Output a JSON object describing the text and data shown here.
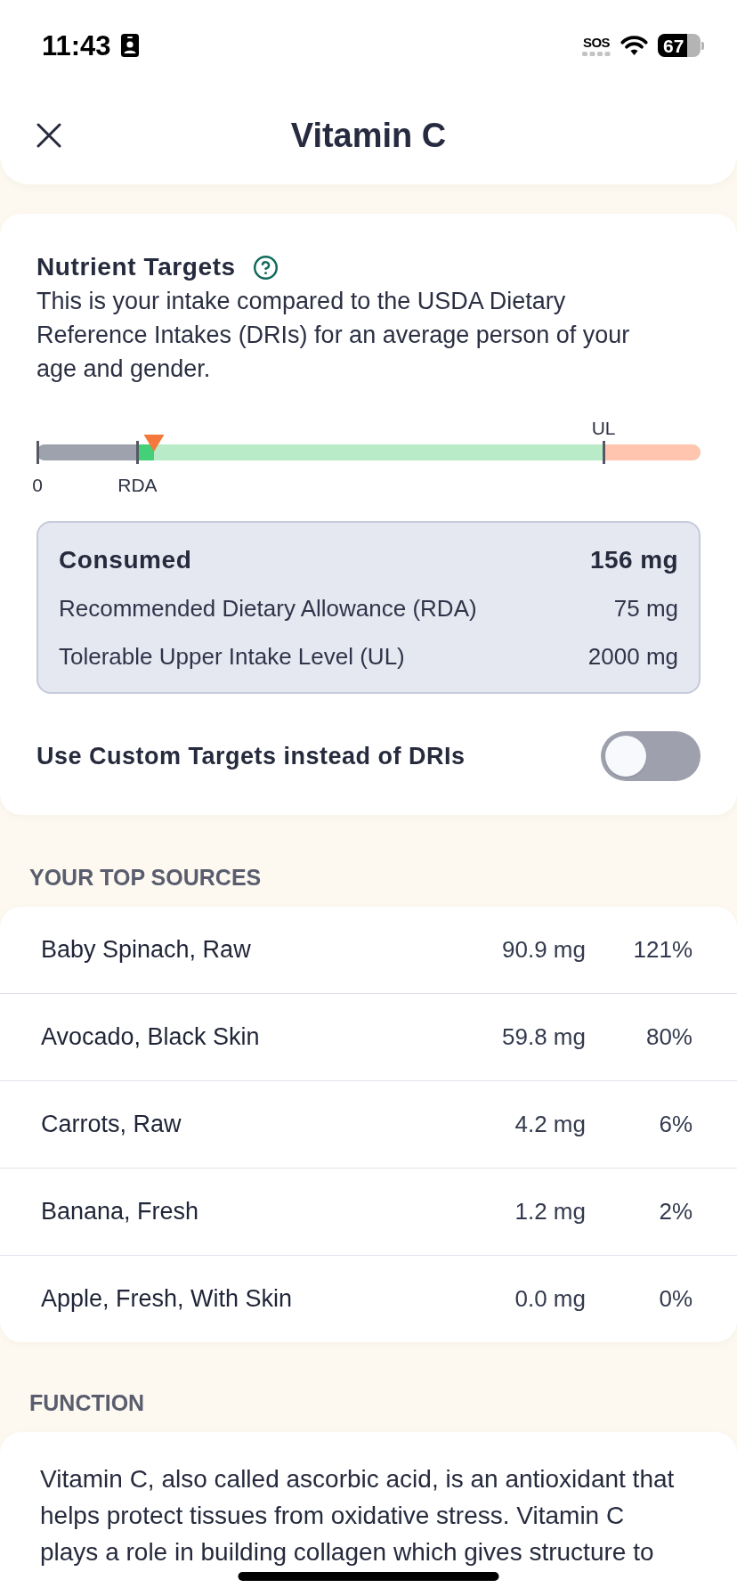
{
  "status_bar": {
    "time": "11:43",
    "network": "SOS",
    "battery": "67"
  },
  "header": {
    "title": "Vitamin C"
  },
  "nutrient_targets": {
    "title": "Nutrient Targets",
    "description": "This is your intake compared to the USDA Dietary Reference Intakes (DRIs) for an average person of your age and gender.",
    "intake_scale": {
      "level": 0.177,
      "ticks": [
        {
          "label": "0"
        },
        {
          "label": "RDA"
        },
        {
          "label": "UL"
        }
      ]
    },
    "summary": [
      {
        "kind": "total",
        "label": "Consumed",
        "value": "156 mg"
      },
      {
        "kind": "reference",
        "label": "Recommended Dietary Allowance (RDA)",
        "value": "75 mg"
      },
      {
        "kind": "reference",
        "label": "Tolerable Upper Intake Level (UL)",
        "value": "2000 mg"
      }
    ],
    "custom_targets": {
      "label": "Use Custom Targets instead of DRIs",
      "on": false
    }
  },
  "top_sources": {
    "heading": "YOUR TOP SOURCES",
    "rows": [
      {
        "food": "Baby Spinach, Raw",
        "amount": "90.9 mg",
        "percent": "121%"
      },
      {
        "food": "Avocado, Black Skin",
        "amount": "59.8 mg",
        "percent": "80%"
      },
      {
        "food": "Carrots, Raw",
        "amount": "4.2 mg",
        "percent": "6%"
      },
      {
        "food": "Banana, Fresh",
        "amount": "1.2 mg",
        "percent": "2%"
      },
      {
        "food": "Apple, Fresh, With Skin",
        "amount": "0.0 mg",
        "percent": "0%"
      }
    ]
  },
  "function": {
    "heading": "FUNCTION",
    "text": "Vitamin C, also called ascorbic acid, is an antioxidant that helps protect tissues from oxidative stress. Vitamin C plays a role in building collagen which gives structure to"
  }
}
